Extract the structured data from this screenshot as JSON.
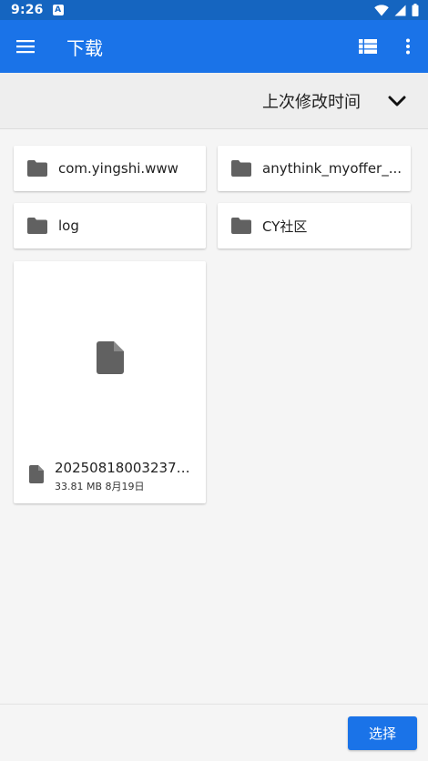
{
  "status_bar": {
    "time": "9:26",
    "notification_glyph": "A",
    "icons": [
      "wifi-icon",
      "signal-icon",
      "battery-icon"
    ]
  },
  "app_bar": {
    "title": "下载",
    "icons": [
      "menu-icon",
      "list-view-icon",
      "more-vert-icon"
    ],
    "color": "#1a73e8"
  },
  "sort": {
    "label": "上次修改时间",
    "icon": "chevron-down-icon"
  },
  "folders": [
    {
      "name": "com.yingshi.www"
    },
    {
      "name": "anythink_myoffer_..."
    },
    {
      "name": "log"
    },
    {
      "name": "CY社区"
    }
  ],
  "files": [
    {
      "name": "20250818003237....",
      "size": "33.81 MB",
      "date": "8月19日"
    }
  ],
  "bottom_bar": {
    "select_label": "选择"
  }
}
